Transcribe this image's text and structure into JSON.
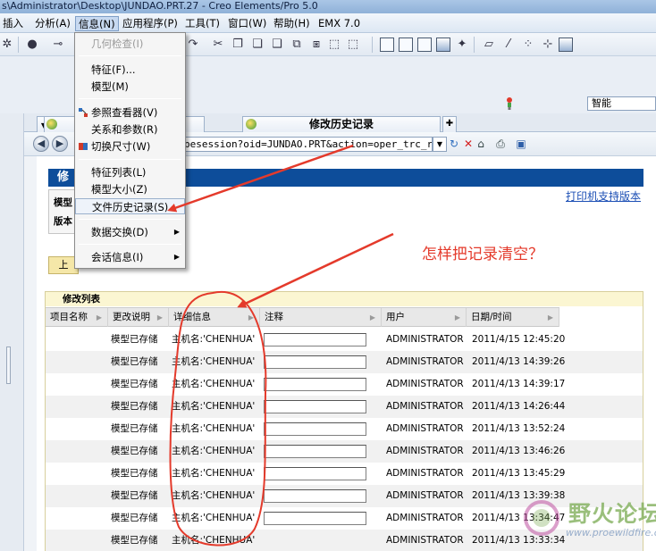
{
  "window": {
    "title": "s\\Administrator\\Desktop\\JUNDAO.PRT.27 - Creo Elements/Pro 5.0"
  },
  "menubar": {
    "items": [
      "插入",
      "分析(A)",
      "信息(N)",
      "应用程序(P)",
      "工具(T)",
      "窗口(W)",
      "帮助(H)",
      "EMX 7.0"
    ]
  },
  "info_menu": {
    "geometry_check": "几何检查(I)",
    "feature": "特征(F)...",
    "model": "模型(M)",
    "reference_viewer": "参照查看器(V)",
    "relations_params": "关系和参数(R)",
    "switch_dims": "切换尺寸(W)",
    "feature_list": "特征列表(L)",
    "model_size": "模型大小(Z)",
    "file_history": "文件历史记录(S)",
    "data_exchange": "数据交换(D)",
    "session_info": "会话信息(I)"
  },
  "secondbar": {
    "smart_select": "智能"
  },
  "tabs": {
    "active_tab": "修改历史记录"
  },
  "address": {
    "url": "pesession?oid=JUNDAO.PRT&action=oper_trc_rpt"
  },
  "page": {
    "header_title": "修",
    "print_link": "打印机支持版本",
    "model_label": "模型",
    "version_label": "版本",
    "back_button": "上",
    "list_title": "修改列表"
  },
  "table": {
    "columns": [
      "项目名称",
      "更改说明",
      "详细信息",
      "注释",
      "用户",
      "日期/时间"
    ],
    "rows": [
      {
        "change": "模型已存储",
        "detail": "主机名:'CHENHUA'",
        "user": "ADMINISTRATOR",
        "date": "2011/4/15 12:45:20"
      },
      {
        "change": "模型已存储",
        "detail": "主机名:'CHENHUA'",
        "user": "ADMINISTRATOR",
        "date": "2011/4/13 14:39:26"
      },
      {
        "change": "模型已存储",
        "detail": "主机名:'CHENHUA'",
        "user": "ADMINISTRATOR",
        "date": "2011/4/13 14:39:17"
      },
      {
        "change": "模型已存储",
        "detail": "主机名:'CHENHUA'",
        "user": "ADMINISTRATOR",
        "date": "2011/4/13 14:26:44"
      },
      {
        "change": "模型已存储",
        "detail": "主机名:'CHENHUA'",
        "user": "ADMINISTRATOR",
        "date": "2011/4/13 13:52:24"
      },
      {
        "change": "模型已存储",
        "detail": "主机名:'CHENHUA'",
        "user": "ADMINISTRATOR",
        "date": "2011/4/13 13:46:26"
      },
      {
        "change": "模型已存储",
        "detail": "主机名:'CHENHUA'",
        "user": "ADMINISTRATOR",
        "date": "2011/4/13 13:45:29"
      },
      {
        "change": "模型已存储",
        "detail": "主机名:'CHENHUA'",
        "user": "ADMINISTRATOR",
        "date": "2011/4/13 13:39:38"
      },
      {
        "change": "模型已存储",
        "detail": "主机名:'CHENHUA'",
        "user": "ADMINISTRATOR",
        "date": "2011/4/13 13:34:47"
      },
      {
        "change": "模型已存储",
        "detail": "主机名:'CHENHUA'",
        "user": "ADMINISTRATOR",
        "date": "2011/4/13 13:33:34"
      }
    ]
  },
  "annotation": {
    "question": "怎样把记录清空？",
    "color": "#e43a2b"
  },
  "watermark": {
    "title": "野火论坛",
    "url": "www.proewildfire.cn"
  },
  "colors": {
    "header_band": "#0d4d9a",
    "list_title_bg": "#fbf6d2",
    "link": "#1c4fb5"
  }
}
